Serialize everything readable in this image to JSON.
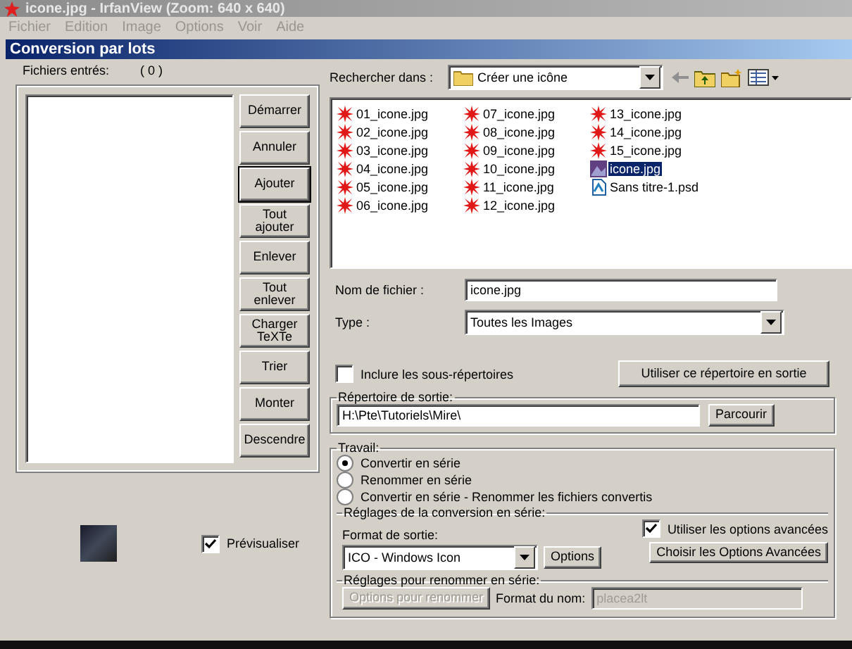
{
  "app_title": "icone.jpg - IrfanView (Zoom: 640 x 640)",
  "menu": [
    "Fichier",
    "Edition",
    "Image",
    "Options",
    "Voir",
    "Aide"
  ],
  "dialog": {
    "title": "Conversion par lots"
  },
  "input_files": {
    "label": "Fichiers entrés:",
    "count": "( 0 )"
  },
  "list_buttons": [
    {
      "label": "Démarrer",
      "focused": false
    },
    {
      "label": "Annuler",
      "focused": false
    },
    {
      "label": "Ajouter",
      "focused": true
    },
    {
      "label": "Tout ajouter",
      "focused": false
    },
    {
      "label": "Enlever",
      "focused": false
    },
    {
      "label": "Tout enlever",
      "focused": false
    },
    {
      "label": "Charger TeXTe",
      "focused": false
    },
    {
      "label": "Trier",
      "focused": false
    },
    {
      "label": "Monter",
      "focused": false
    },
    {
      "label": "Descendre",
      "focused": false
    }
  ],
  "browser": {
    "look_in_label": "Rechercher dans :",
    "folder": "Créer une icône",
    "files": [
      {
        "name": "01_icone.jpg",
        "kind": "jpg",
        "selected": false
      },
      {
        "name": "02_icone.jpg",
        "kind": "jpg",
        "selected": false
      },
      {
        "name": "03_icone.jpg",
        "kind": "jpg",
        "selected": false
      },
      {
        "name": "04_icone.jpg",
        "kind": "jpg",
        "selected": false
      },
      {
        "name": "05_icone.jpg",
        "kind": "jpg",
        "selected": false
      },
      {
        "name": "06_icone.jpg",
        "kind": "jpg",
        "selected": false
      },
      {
        "name": "07_icone.jpg",
        "kind": "jpg",
        "selected": false
      },
      {
        "name": "08_icone.jpg",
        "kind": "jpg",
        "selected": false
      },
      {
        "name": "09_icone.jpg",
        "kind": "jpg",
        "selected": false
      },
      {
        "name": "10_icone.jpg",
        "kind": "jpg",
        "selected": false
      },
      {
        "name": "11_icone.jpg",
        "kind": "jpg",
        "selected": false
      },
      {
        "name": "12_icone.jpg",
        "kind": "jpg",
        "selected": false
      },
      {
        "name": "13_icone.jpg",
        "kind": "jpg",
        "selected": false
      },
      {
        "name": "14_icone.jpg",
        "kind": "jpg",
        "selected": false
      },
      {
        "name": "15_icone.jpg",
        "kind": "jpg",
        "selected": false
      },
      {
        "name": "icone.jpg",
        "kind": "thumb",
        "selected": true
      },
      {
        "name": "Sans titre-1.psd",
        "kind": "psd",
        "selected": false
      }
    ],
    "file_name_label": "Nom de fichier :",
    "file_name": "icone.jpg",
    "type_label": "Type :",
    "type": "Toutes les Images"
  },
  "include_subdirs": {
    "label": "Inclure les sous-répertoires",
    "checked": false
  },
  "use_dir_button": "Utiliser ce répertoire en sortie",
  "output_dir": {
    "legend": "Répertoire de sortie:",
    "value": "H:\\Pte\\Tutoriels\\Mire\\",
    "browse": "Parcourir"
  },
  "work": {
    "legend": "Travail:",
    "options": [
      {
        "label": "Convertir en série",
        "selected": true
      },
      {
        "label": "Renommer en série",
        "selected": false
      },
      {
        "label": "Convertir en série - Renommer les fichiers convertis",
        "selected": false
      }
    ]
  },
  "conversion": {
    "legend": "Réglages de la conversion en série:",
    "format_label": "Format de sortie:",
    "format": "ICO - Windows Icon",
    "options_button": "Options",
    "advanced": {
      "label": "Utiliser les options avancées",
      "checked": true
    },
    "advanced_button": "Choisir les Options Avancées"
  },
  "rename": {
    "legend": "Réglages pour renommer en série:",
    "options_button": {
      "label": "Options pour renommer",
      "disabled": true
    },
    "name_format_label": "Format du nom:",
    "name_format": {
      "value": "placea2lt",
      "disabled": true
    }
  },
  "preview": {
    "label": "Prévisualiser",
    "checked": true
  }
}
